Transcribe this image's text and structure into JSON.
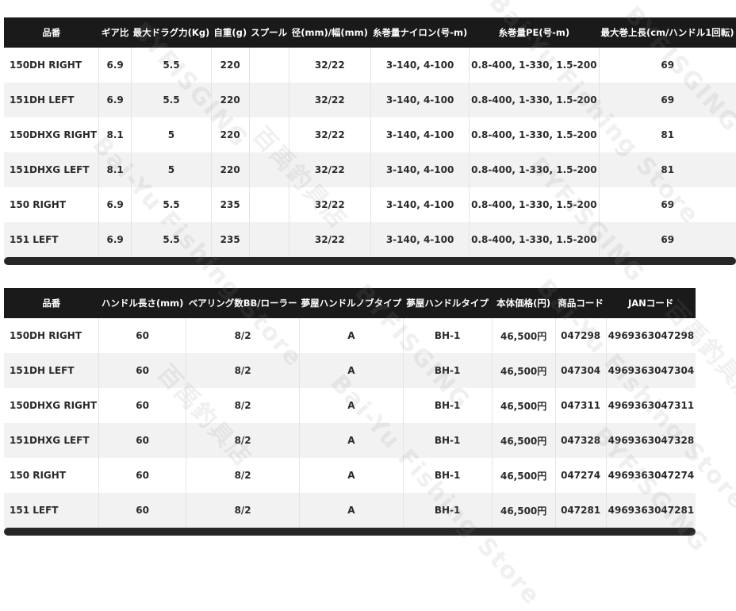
{
  "table1": {
    "headers": [
      "品番",
      "ギア比",
      "最大ドラグ力(Kg)",
      "自重(g)",
      "スプール",
      "径(mm)/幅(mm)",
      "糸巻量ナイロン(号-m)",
      "糸巻量PE(号-m)",
      "最大巻上長(cm/ハンドル1回転)"
    ],
    "rows": [
      [
        "150DH RIGHT",
        "6.9",
        "5.5",
        "220",
        "",
        "32/22",
        "3-140, 4-100",
        "0.8-400, 1-330, 1.5-200",
        "69"
      ],
      [
        "151DH LEFT",
        "6.9",
        "5.5",
        "220",
        "",
        "32/22",
        "3-140, 4-100",
        "0.8-400, 1-330, 1.5-200",
        "69"
      ],
      [
        "150DHXG RIGHT",
        "8.1",
        "5",
        "220",
        "",
        "32/22",
        "3-140, 4-100",
        "0.8-400, 1-330, 1.5-200",
        "81"
      ],
      [
        "151DHXG LEFT",
        "8.1",
        "5",
        "220",
        "",
        "32/22",
        "3-140, 4-100",
        "0.8-400, 1-330, 1.5-200",
        "81"
      ],
      [
        "150 RIGHT",
        "6.9",
        "5.5",
        "235",
        "",
        "32/22",
        "3-140, 4-100",
        "0.8-400, 1-330, 1.5-200",
        "69"
      ],
      [
        "151 LEFT",
        "6.9",
        "5.5",
        "235",
        "",
        "32/22",
        "3-140, 4-100",
        "0.8-400, 1-330, 1.5-200",
        "69"
      ]
    ]
  },
  "table2": {
    "headers": [
      "品番",
      "ハンドル長さ(mm)",
      "ベアリング数BB/ローラー",
      "夢屋ハンドルノブタイプ",
      "夢屋ハンドルタイプ",
      "本体価格(円)",
      "商品コード",
      "JANコード"
    ],
    "rows": [
      [
        "150DH RIGHT",
        "60",
        "8/2",
        "A",
        "BH-1",
        "46,500円",
        "047298",
        "4969363047298"
      ],
      [
        "151DH LEFT",
        "60",
        "8/2",
        "A",
        "BH-1",
        "46,500円",
        "047304",
        "4969363047304"
      ],
      [
        "150DHXG RIGHT",
        "60",
        "8/2",
        "A",
        "BH-1",
        "46,500円",
        "047311",
        "4969363047311"
      ],
      [
        "151DHXG LEFT",
        "60",
        "8/2",
        "A",
        "BH-1",
        "46,500円",
        "047328",
        "4969363047328"
      ],
      [
        "150 RIGHT",
        "60",
        "8/2",
        "A",
        "BH-1",
        "46,500円",
        "047274",
        "4969363047274"
      ],
      [
        "151 LEFT",
        "60",
        "8/2",
        "A",
        "BH-1",
        "46,500円",
        "047281",
        "4969363047281"
      ]
    ]
  },
  "watermark": {
    "lines": [
      "BYFISGING",
      "Bai-Yu Fishing Store",
      "百禹釣具店"
    ]
  },
  "colors": {
    "header_bg": "#1a1a1a",
    "header_text": "#ffffff",
    "alt_row_bg": "#f2f2f2",
    "scrollbar": "#262626"
  }
}
